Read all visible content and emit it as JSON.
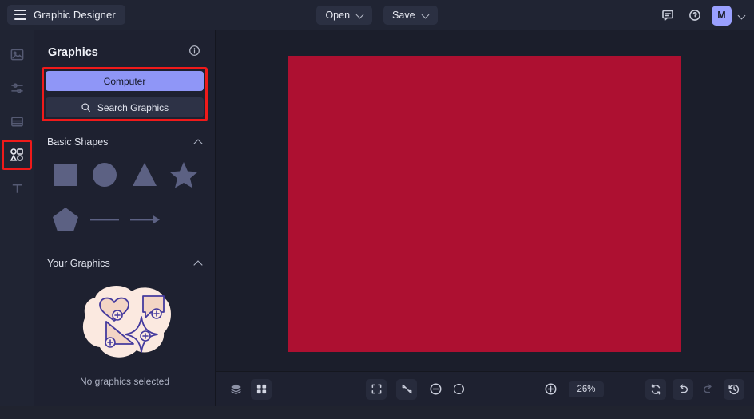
{
  "app": {
    "title": "Graphic Designer",
    "menu_icon": "hamburger-icon"
  },
  "topbar": {
    "open_label": "Open",
    "save_label": "Save",
    "comment_icon": "comment-icon",
    "help_icon": "help-circle-icon",
    "avatar_initial": "M",
    "accent_color": "#9aa0ff"
  },
  "rail": {
    "items": [
      {
        "name": "image-tool",
        "icon": "image-icon",
        "active": false
      },
      {
        "name": "adjustments-tool",
        "icon": "sliders-icon",
        "active": false
      },
      {
        "name": "layout-tool",
        "icon": "layout-icon",
        "active": false
      },
      {
        "name": "shapes-tool",
        "icon": "shapes-grid-icon",
        "active": true
      },
      {
        "name": "text-tool",
        "icon": "text-icon",
        "active": false
      }
    ],
    "highlight_color": "#f01a1a"
  },
  "panel": {
    "title": "Graphics",
    "info_icon": "info-icon",
    "source_button": "Computer",
    "search_button": "Search Graphics",
    "search_icon": "search-icon",
    "sections": [
      {
        "title": "Basic Shapes",
        "collapse_icon": "chevron-up-icon"
      },
      {
        "title": "Your Graphics",
        "collapse_icon": "chevron-up-icon"
      }
    ],
    "shapes": [
      "square",
      "circle",
      "triangle",
      "star",
      "pentagon",
      "line",
      "arrow"
    ],
    "empty_state": "No graphics selected",
    "primary_button_color": "#8f96f7"
  },
  "canvas": {
    "fill_color": "#ad1031"
  },
  "bottombar": {
    "layers_icon": "layers-icon",
    "grid_icon": "grid-icon",
    "fit_icon": "fit-screen-icon",
    "collapse_icon": "collapse-arrows-icon",
    "zoom_out_icon": "zoom-out-icon",
    "zoom_in_icon": "zoom-in-icon",
    "zoom_level": "26%",
    "reset_icon": "refresh-icon",
    "undo_icon": "undo-icon",
    "redo_icon": "redo-icon",
    "history_icon": "history-icon"
  }
}
